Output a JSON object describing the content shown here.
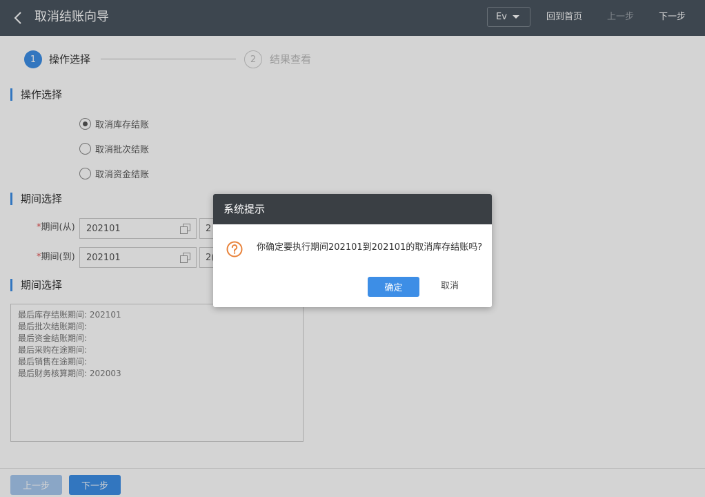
{
  "header": {
    "title": "取消结账向导",
    "language": "Ev",
    "home": "回到首页",
    "prev": "上一步",
    "next": "下一步"
  },
  "steps": [
    {
      "num": "1",
      "label": "操作选择"
    },
    {
      "num": "2",
      "label": "结果查看"
    }
  ],
  "operation": {
    "title": "操作选择",
    "options": [
      {
        "label": "取消库存结账",
        "checked": true
      },
      {
        "label": "取消批次结账",
        "checked": false
      },
      {
        "label": "取消资金结账",
        "checked": false
      }
    ]
  },
  "period": {
    "title": "期间选择",
    "required_mark": "*",
    "from_label": "期间(从)",
    "from_value": "202101",
    "from_value2": "2",
    "to_label": "期间(到)",
    "to_value": "202101",
    "to_value2": "2("
  },
  "info": {
    "title": "期间选择",
    "lines": [
      "最后库存结账期间: 202101",
      "最后批次结账期间:",
      "最后资金结账期间:",
      "最后采购在途期间:",
      "最后销售在途期间:",
      "最后财务核算期间: 202003"
    ]
  },
  "footer": {
    "prev": "上一步",
    "next": "下一步"
  },
  "dialog": {
    "title": "系统提示",
    "message": "你确定要执行期间202101到202101的取消库存结账吗?",
    "ok": "确定",
    "cancel": "取消",
    "icon": "question-icon",
    "icon_color": "#e8823a"
  },
  "colors": {
    "accent": "#3d8ee6",
    "header_bg": "#4a5560",
    "dialog_header_bg": "#3a3f44"
  }
}
